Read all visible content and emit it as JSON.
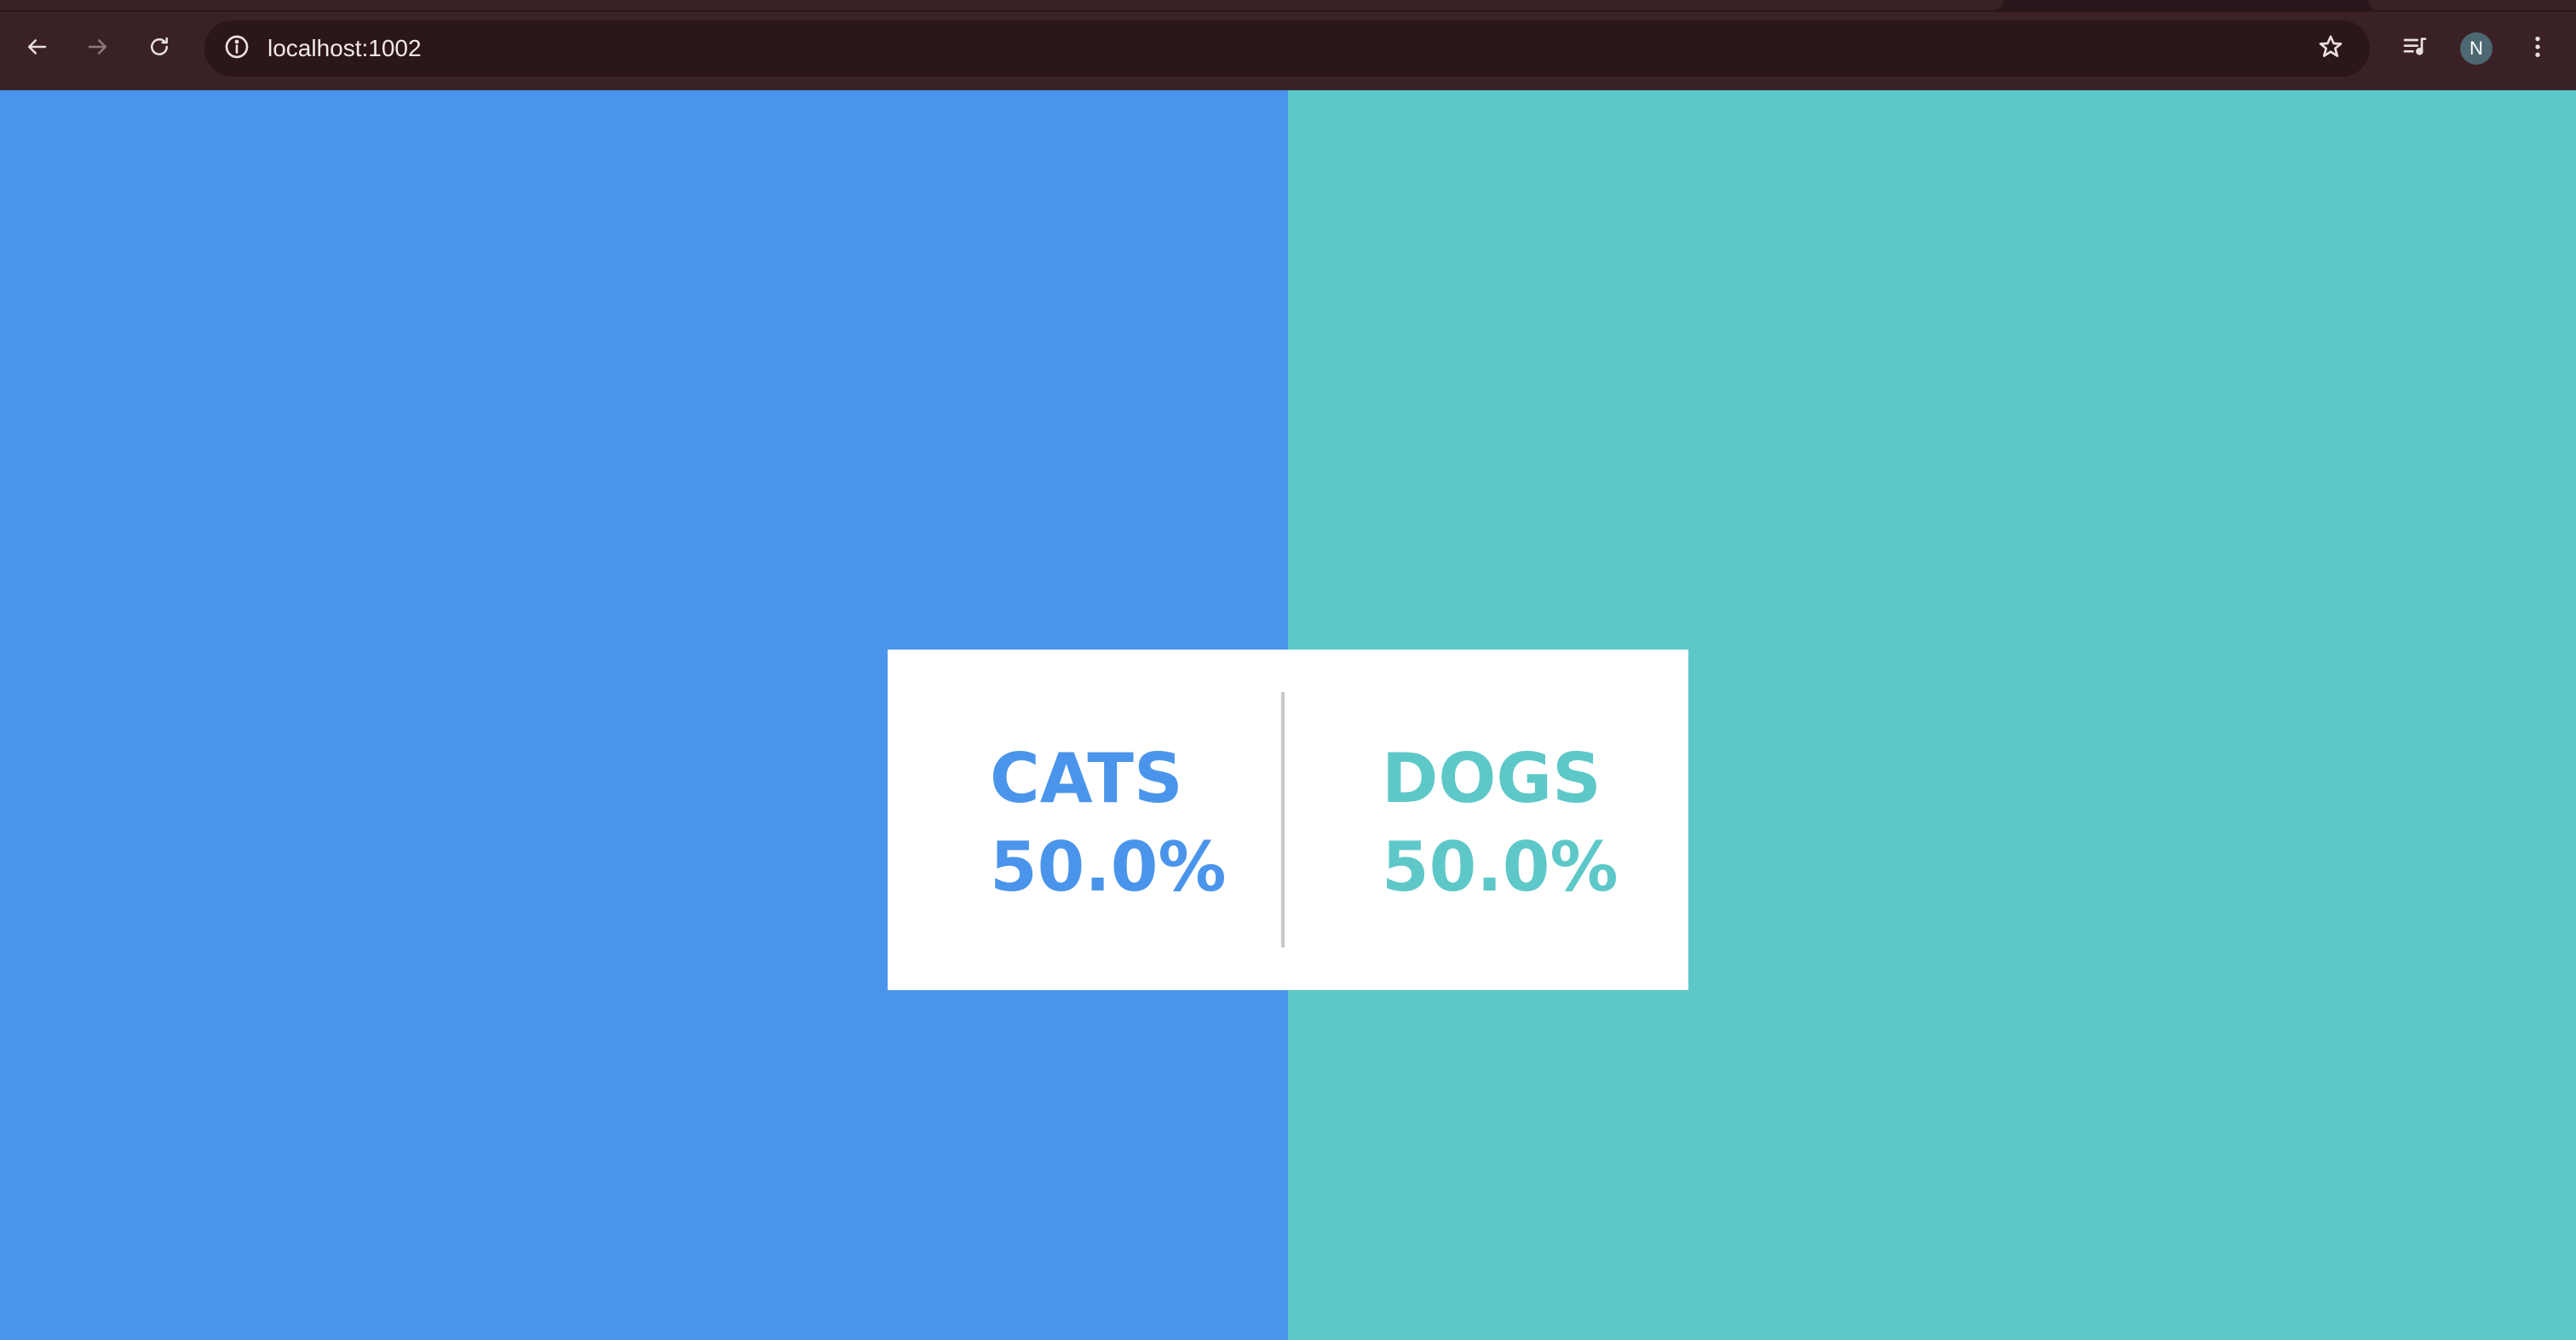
{
  "browser": {
    "url": "localhost:1002",
    "profile_initial": "N",
    "icons": {
      "back": "arrow-left-icon",
      "forward": "arrow-right-icon",
      "reload": "reload-icon",
      "site_info": "info-circle-icon",
      "bookmark": "star-icon",
      "media": "media-queue-icon",
      "menu": "kebab-menu-icon"
    }
  },
  "votes": {
    "colors": {
      "cats": "#4a95eb",
      "dogs": "#5ec8c9"
    },
    "cats": {
      "label": "CATS",
      "percent": "50.0%"
    },
    "dogs": {
      "label": "DOGS",
      "percent": "50.0%"
    }
  }
}
